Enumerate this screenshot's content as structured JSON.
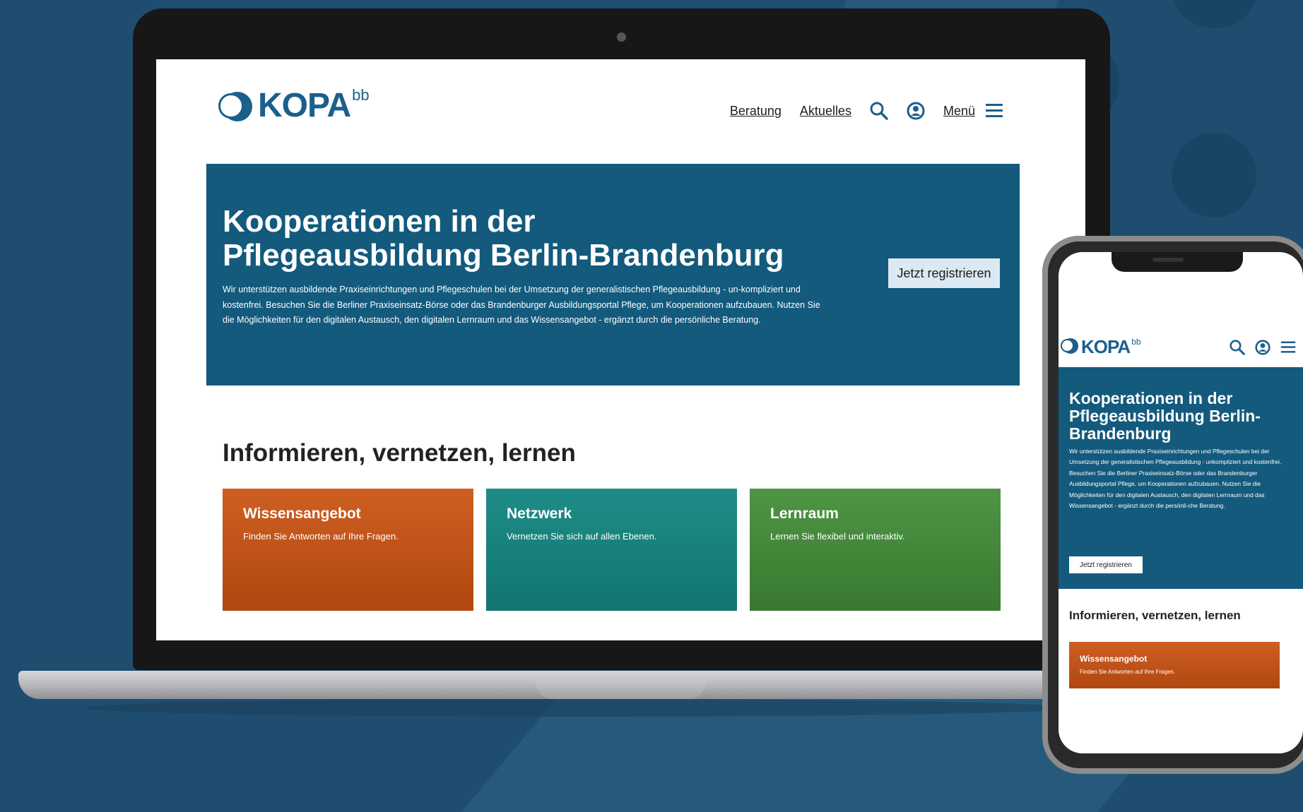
{
  "brand": {
    "logo_text": "KOPA",
    "logo_sup": "bb"
  },
  "nav": {
    "links": [
      "Beratung",
      "Aktuelles"
    ],
    "search_icon": "search-icon",
    "user_icon": "user-icon",
    "menu_label": "Menü",
    "menu_icon": "hamburger-icon"
  },
  "hero": {
    "title_line1": "Kooperationen in der",
    "title_line2": "Pflegeausbildung Berlin-Brandenburg",
    "text": "Wir unterstützen ausbildende Praxiseinrichtungen und Pflegeschulen bei der Umsetzung der generalistischen Pflegeausbildung - un-kompliziert und kostenfrei. Besuchen Sie die Berliner Praxiseinsatz-Börse oder das Brandenburger Ausbildungsportal Pflege, um Kooperationen aufzubauen. Nutzen Sie die Möglichkeiten für den digitalen Austausch, den digitalen Lernraum und das Wissensangebot - ergänzt durch die persönliche Beratung.",
    "button": "Jetzt registrieren"
  },
  "section": {
    "title": "Informieren, vernetzen, lernen",
    "cards": [
      {
        "title": "Wissensangebot",
        "text": "Finden Sie Antworten auf Ihre Fragen."
      },
      {
        "title": "Netzwerk",
        "text": "Vernetzen Sie sich auf allen Ebenen."
      },
      {
        "title": "Lernraum",
        "text": "Lernen Sie flexibel und interaktiv."
      }
    ]
  },
  "mobile": {
    "hero_title": "Kooperationen in der Pflegeausbildung Berlin-Brandenburg",
    "hero_text": "Wir unterstützen ausbildende Praxiseinrichtungen und Pflegeschulen bei der Umsetzung der generalistischen Pflegeausbildung - unkompliziert und kostenfrei. Besuchen Sie die Berliner Praxiseinsatz-Börse oder das Brandenburger Ausbildungsportal Pflege, um Kooperationen aufzubauen. Nutzen Sie die Möglichkeiten für den digitalen Austausch, den digitalen Lernraum und das Wissensangebot - ergänzt durch die persönli-che Beratung.",
    "button": "Jetzt registrieren",
    "section_title": "Informieren, vernetzen, lernen",
    "card_title": "Wissensangebot",
    "card_text": "Finden Sie Antworten auf Ihre Fragen."
  },
  "colors": {
    "background": "#1f4d6f",
    "hero": "#135a7d",
    "orange": "#c0521a",
    "teal": "#1a817c",
    "green": "#44883b"
  }
}
